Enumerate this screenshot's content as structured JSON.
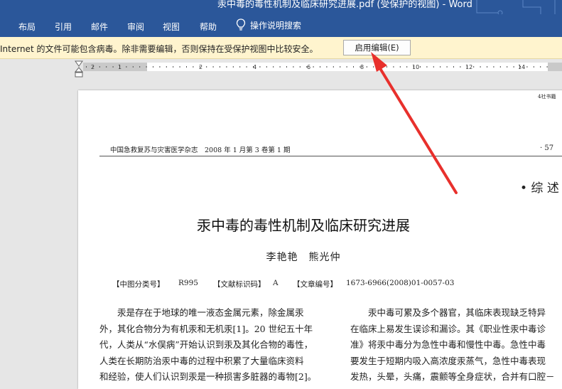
{
  "window": {
    "title": "汞中毒的毒性机制及临床研究进展.pdf (受保护的视图)  -  Word"
  },
  "ribbon": {
    "tabs": [
      "布局",
      "引用",
      "邮件",
      "审阅",
      "视图",
      "帮助"
    ],
    "tell_me": "操作说明搜索"
  },
  "protected_view": {
    "message": "Internet 的文件可能包含病毒。除非需要编辑，否则保持在受保护视图中比较安全。",
    "enable_button": "启用编辑(E)"
  },
  "ruler": {
    "left_labels": [
      "2",
      "1"
    ],
    "right_labels": [
      "2",
      "4",
      "6",
      "8",
      "10",
      "12",
      "14"
    ]
  },
  "document": {
    "corner_text": "4社书籍",
    "journal_header": "中国急救复苏与灾害医学杂志　2008 年 1 月第 3 卷第 1 期",
    "page_number": "· 57",
    "section": "• 综 述",
    "title": "汞中毒的毒性机制及临床研究进展",
    "authors": "李艳艳　熊光仲",
    "clc_label": "【中图分类号】",
    "clc_value": "R995",
    "doc_code_label": "【文献标识码】",
    "doc_code_value": "A",
    "article_no_label": "【文章编号】",
    "article_no_value": "1673-6966(2008)01-0057-03",
    "left_column": [
      "　　汞是存在于地球的唯一液态金属元素，除金属汞",
      "外，其化合物分为有机汞和无机汞[1]。20 世纪五十年",
      "代，人类从“水俣病”开始认识到汞及其化合物的毒性，",
      "人类在长期防治汞中毒的过程中积累了大量临床资料",
      "和经验，使人们认识到汞是一种损害多脏器的毒物[2]。"
    ],
    "right_column": [
      "　　汞中毒可累及多个器官，其临床表现缺乏特异",
      "在临床上易发生误诊和漏诊。其《职业性汞中毒诊",
      "准》将汞中毒分为急性中毒和慢性中毒。急性中毒",
      "要发生于短期内吸入高浓度汞蒸气，急性中毒表现",
      "发热，头晕，头痛，震颤等全身症状，合并有口腔－"
    ]
  },
  "colors": {
    "ribbon_blue": "#2b579a",
    "message_bar": "#fff4ce",
    "arrow_red": "#e8302c"
  }
}
